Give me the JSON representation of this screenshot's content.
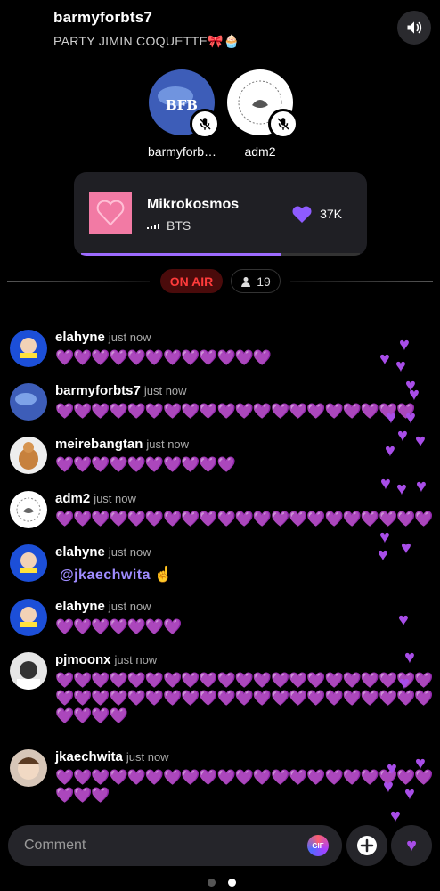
{
  "header": {
    "host_name": "barmyforbts7",
    "room_title": "PARTY JIMIN COQUETTE🎀🧁"
  },
  "speakers": [
    {
      "name": "barmyforb…",
      "avatar_text": "BFB"
    },
    {
      "name": "adm2",
      "avatar_text": ""
    }
  ],
  "music": {
    "title": "Mikrokosmos",
    "artist": "BTS",
    "likes": "37K",
    "progress": 0.72
  },
  "status": {
    "on_air": "ON AIR",
    "listeners": "19"
  },
  "comments": [
    {
      "user": "elahyne",
      "time": "just now",
      "text": "💜💜💜💜💜💜💜💜💜💜💜💜"
    },
    {
      "user": "barmyforbts7",
      "time": "just now",
      "text": "💜💜💜💜💜💜💜💜💜💜💜💜💜💜💜💜💜💜💜💜"
    },
    {
      "user": "meirebangtan",
      "time": "just now",
      "text": "💜💜💜💜💜💜💜💜💜💜"
    },
    {
      "user": "adm2",
      "time": "just now",
      "text": "💜💜💜💜💜💜💜💜💜💜💜💜💜💜💜💜💜💜💜💜💜"
    },
    {
      "user": "elahyne",
      "time": "just now",
      "mention": "@jkaechwita",
      "text": "☝️"
    },
    {
      "user": "elahyne",
      "time": "just now",
      "text": "💜💜💜💜💜💜💜"
    },
    {
      "user": "pjmoonx",
      "time": "just now",
      "text": "💜💜💜💜💜💜💜💜💜💜💜💜💜💜💜💜💜💜💜💜💜💜💜💜💜💜💜💜💜💜💜💜💜💜💜💜💜💜💜💜💜💜💜💜💜💜"
    },
    {
      "user": "jkaechwita",
      "time": "just now",
      "text": "💜💜💜💜💜💜💜💜💜💜💜💜💜💜💜💜💜💜💜💜💜💜💜💜"
    }
  ],
  "input": {
    "placeholder": "Comment",
    "gif_label": "GIF"
  },
  "pager": {
    "pages": 2,
    "active": 2
  }
}
